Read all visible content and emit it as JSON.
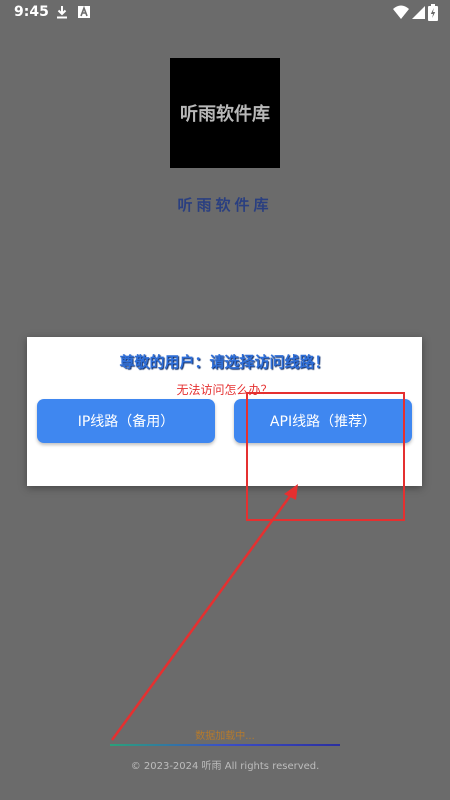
{
  "status_bar": {
    "time": "9:45",
    "icons": [
      "download-icon",
      "app-notification-icon",
      "wifi-icon",
      "signal-icon",
      "battery-charging-icon"
    ]
  },
  "logo": {
    "text": "听雨软件库"
  },
  "app_name": "听雨软件库",
  "dialog": {
    "title": "尊敬的用户：请选择访问线路！",
    "subtitle": "无法访问怎么办？",
    "buttons": {
      "ip_label": "IP线路（备用）",
      "api_label": "API线路（推荐）"
    }
  },
  "loading": {
    "text": "数据加载中...",
    "progress": 1.0
  },
  "footer": {
    "text": "© 2023-2024 听雨  All rights reserved."
  },
  "colors": {
    "accent": "#3f87f0",
    "background": "#6b6b6b",
    "annotation": "#e53030"
  }
}
